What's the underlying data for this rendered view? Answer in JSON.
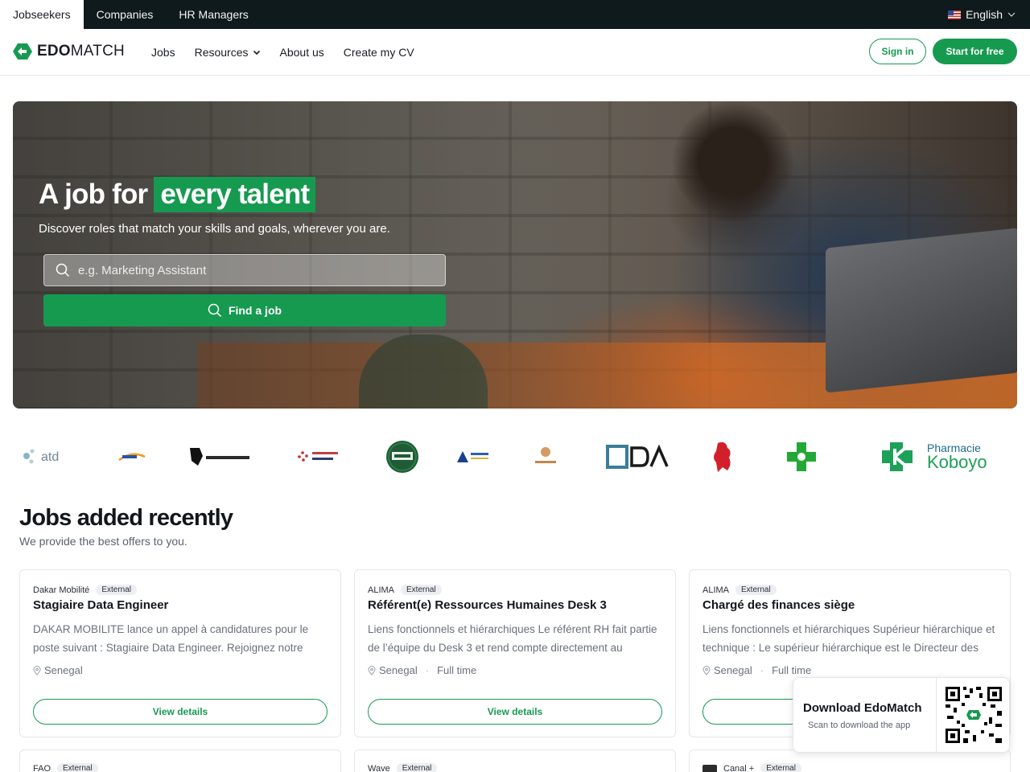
{
  "topbar": {
    "audiences": [
      "Jobseekers",
      "Companies",
      "HR Managers"
    ],
    "language": "English"
  },
  "header": {
    "logo_bold": "EDO",
    "logo_rest": "MATCH",
    "nav": [
      "Jobs",
      "Resources",
      "About us",
      "Create my CV"
    ],
    "sign_in": "Sign in",
    "start_free": "Start for free"
  },
  "hero": {
    "title_prefix": "A job for",
    "title_highlight": "every talent",
    "subtitle": "Discover roles that match your skills and goals, wherever you are.",
    "search_placeholder": "e.g. Marketing Assistant",
    "search_button": "Find a job"
  },
  "partners": {
    "logos": [
      "atd",
      "Maya Africa",
      "DJANTA TECH HUB",
      "brussels airlines",
      "SNB",
      "ALLIO",
      "CALIENDI",
      "CDA",
      "lion-crest",
      "pharmacy-cross",
      "Pharmacie Koboyo"
    ],
    "koboyo_line1": "Pharmacie",
    "koboyo_line2": "Koboyo"
  },
  "jobs": {
    "title": "Jobs added recently",
    "subtitle": "We provide the best offers to you.",
    "view_label": "View details",
    "cards": [
      {
        "company": "Dakar Mobilité",
        "badge": "External",
        "title": "Stagiaire Data Engineer",
        "description": "DAKAR MOBILITE lance un appel à candidatures pour le poste suivant : Stagiaire Data Engineer. Rejoignez notre équipe",
        "location": "Senegal",
        "type": ""
      },
      {
        "company": "ALIMA",
        "badge": "External",
        "title": "Référent(e) Ressources Humaines Desk 3",
        "description": "Liens fonctionnels et hiérarchiques Le référent RH fait partie de l’équipe du Desk 3 et rend compte directement au",
        "location": "Senegal",
        "type": "Full time"
      },
      {
        "company": "ALIMA",
        "badge": "External",
        "title": "Chargé des finances siège",
        "description": "Liens fonctionnels et hiérarchiques Supérieur hiérarchique et technique : Le supérieur hiérarchique est le Directeur des",
        "location": "Senegal",
        "type": "Full time"
      }
    ],
    "next_row": [
      {
        "company": "FAO",
        "badge": "External"
      },
      {
        "company": "Wave",
        "badge": "External"
      },
      {
        "company": "Canal +",
        "badge": "External"
      }
    ]
  },
  "download": {
    "title": "Download EdoMatch",
    "subtitle": "Scan to download the app"
  },
  "colors": {
    "brand_green": "#169a50",
    "topbar_bg": "#0f1a1c"
  },
  "icons": [
    "flag-us-icon",
    "chevron-down-icon",
    "search-icon",
    "location-pin-icon",
    "qr-code-icon"
  ]
}
